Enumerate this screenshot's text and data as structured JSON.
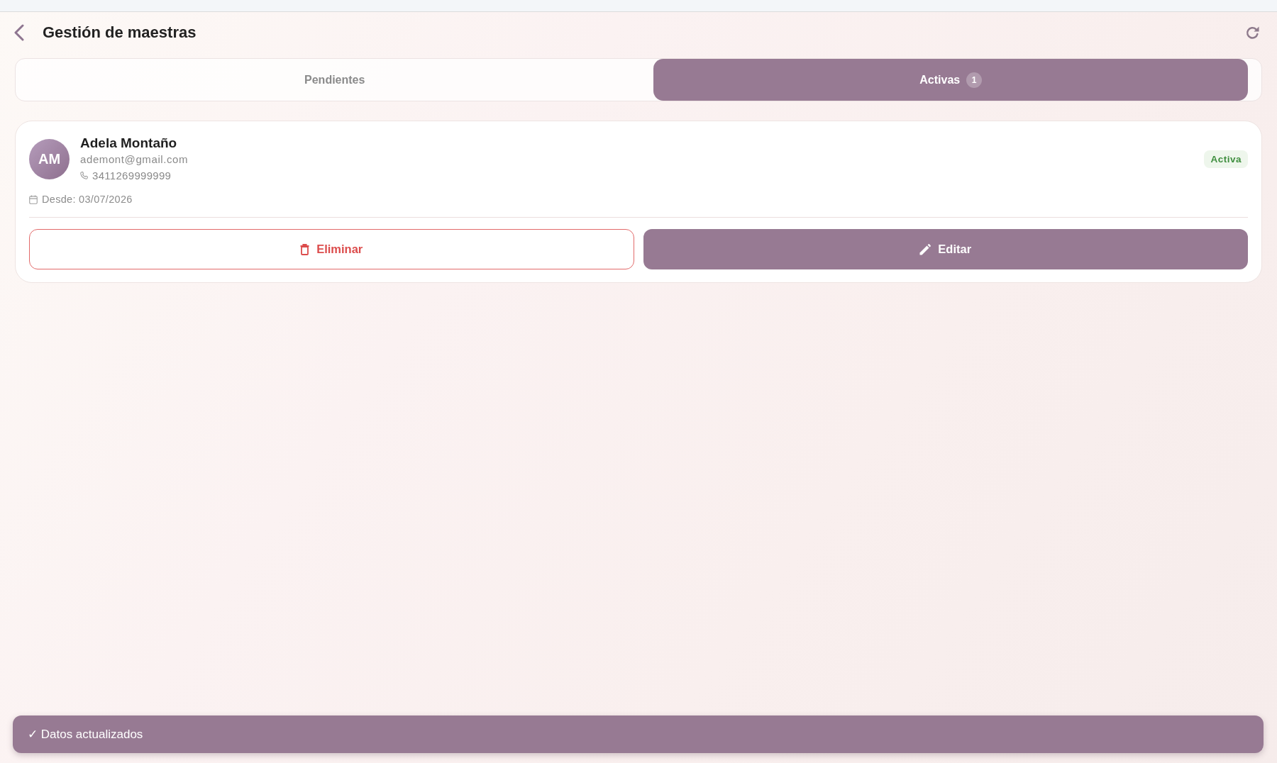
{
  "header": {
    "title": "Gestión de maestras"
  },
  "tabs": [
    {
      "label": "Pendientes",
      "selected": false
    },
    {
      "label": "Activas",
      "count": "1",
      "selected": true
    }
  ],
  "teachers": [
    {
      "initials": "AM",
      "name": "Adela Montaño",
      "email": "ademont@gmail.com",
      "phone": "3411269999999",
      "since": "Desde: 03/07/2026",
      "status": {
        "label": "Activa",
        "kind": "active"
      },
      "actions": [
        {
          "kind": "delete",
          "label": "Eliminar"
        },
        {
          "kind": "edit",
          "label": "Editar"
        }
      ]
    }
  ],
  "toast": {
    "text": "✓ Datos actualizados"
  }
}
